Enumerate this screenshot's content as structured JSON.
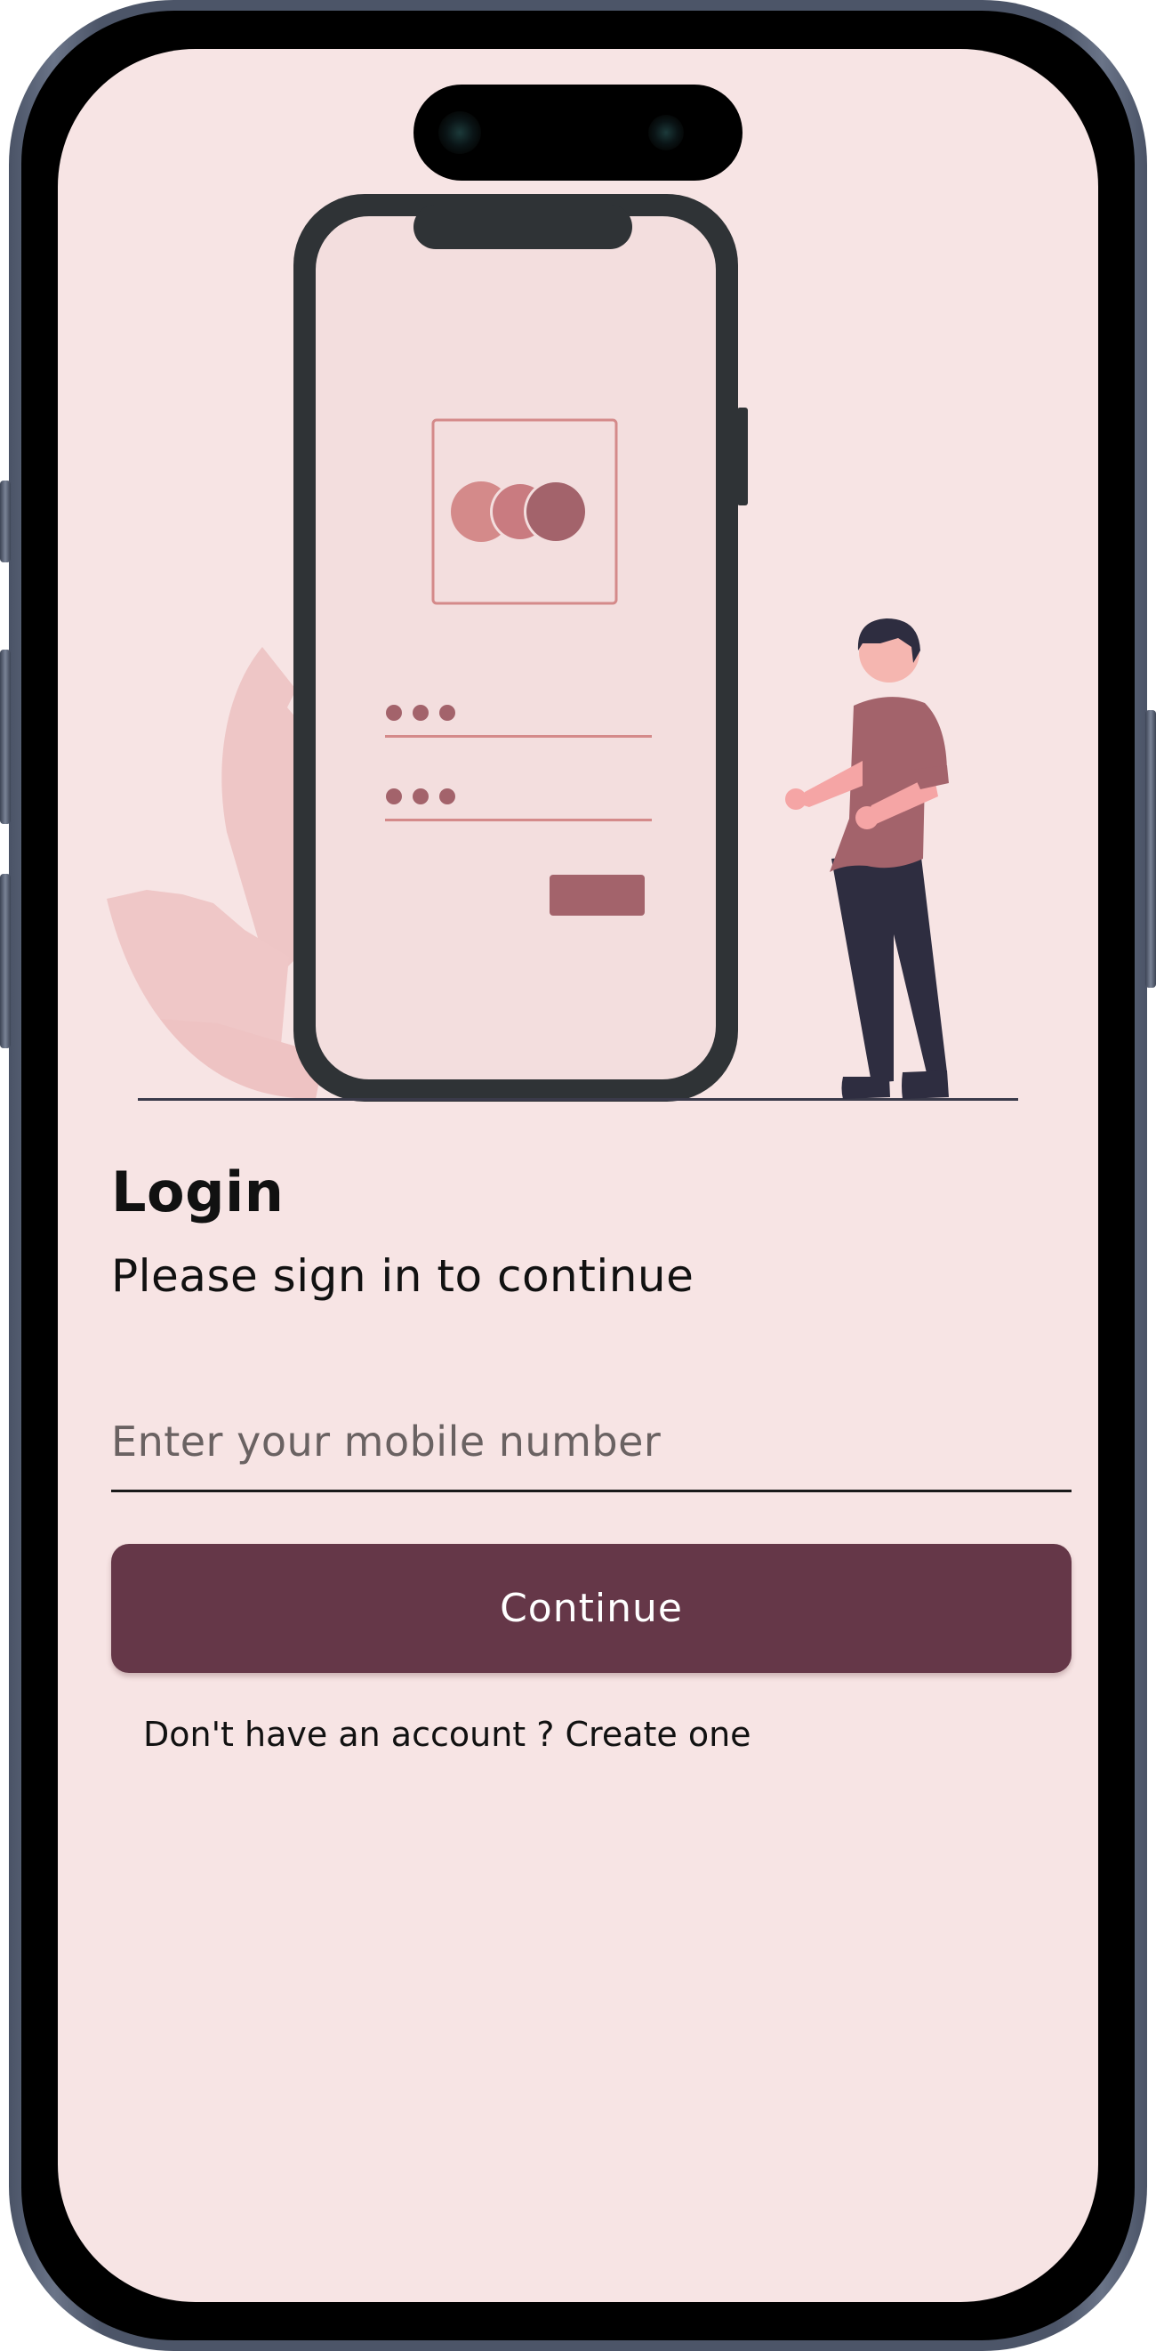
{
  "login": {
    "title": "Login",
    "subtitle": "Please sign in to continue",
    "mobile_placeholder": "Enter your mobile number",
    "mobile_value": "",
    "continue_label": "Continue",
    "signup_text": "Don't have an account ? Create one"
  },
  "colors": {
    "background": "#f7e4e4",
    "primary": "#653748",
    "illustration_accent": "#a3636b",
    "illustration_light": "#d48a8a",
    "device_frame": "#2f3336"
  },
  "illustration": {
    "description_icon": "login-illustration",
    "parts": [
      "phone-mockup",
      "card-logo-icon",
      "password-field",
      "person-figure",
      "leaf-decoration"
    ]
  }
}
